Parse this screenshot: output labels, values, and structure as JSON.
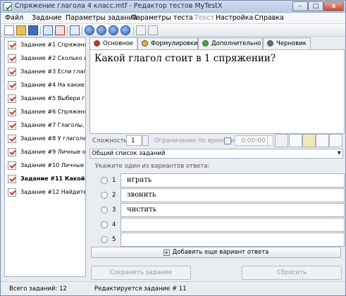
{
  "window": {
    "title": "Спряжение глагола 4 класс.mtf - Редактор тестов MyTestX",
    "min": "–",
    "max": "□",
    "close": "x"
  },
  "menu": [
    "Файл",
    "Задание",
    "Параметры заданий",
    "Параметры теста",
    "Текст",
    "Настройка",
    "Справка"
  ],
  "toolbar": {
    "icons": [
      "new-doc-icon",
      "open-folder-icon",
      "save-icon",
      "add-task-icon",
      "delete-task-icon",
      "task-list-icon",
      "nav-first-icon",
      "nav-prev-icon",
      "nav-next-icon",
      "nav-last-icon",
      "copy-icon",
      "paste-icon"
    ]
  },
  "tasks": [
    "Задание #1 Спряжение",
    "Задание #2 Сколько вре",
    "Задание #3 Если глагол",
    "Задание #4 На какие во",
    "Задание #5 Выбери глаг",
    "Задание #6 Спряжение",
    "Задание #7 Глаголы, ок",
    "Задание #8 У глагола ка",
    "Задание #9 Личные око",
    "Задание #10 Личные око",
    "Задание #11 Какой гл",
    "Задание #12 Найдите гл"
  ],
  "selected_task": 10,
  "tabs": [
    {
      "label": "Основное",
      "color": "#d62b1f"
    },
    {
      "label": "Формулировки",
      "color": "#f0b21c"
    },
    {
      "label": "Дополнительно",
      "color": "#35b035"
    },
    {
      "label": "Черновик",
      "color": "#6a6a6a"
    }
  ],
  "question": "Какой глагол стоит в 1 спряжении?",
  "settings": {
    "difficulty_label": "Сложность:",
    "difficulty_value": "1",
    "time_label": "Ограничение по времени:",
    "time_value": "0:00:00"
  },
  "list_select": "Общий список заданий",
  "answers": {
    "prompt": "Укажите один из вариантов ответа:",
    "numbers": [
      "1",
      "2",
      "3",
      "4",
      "5"
    ],
    "values": [
      "играть",
      "звонить",
      "чистить",
      "",
      ""
    ]
  },
  "buttons": {
    "add": "Добавить еще вариант ответа",
    "save": "Сохранить задание",
    "reset": "Сбросить"
  },
  "status": {
    "total": "Всего заданий: 12",
    "editing": "Редактируется задание # 11"
  }
}
